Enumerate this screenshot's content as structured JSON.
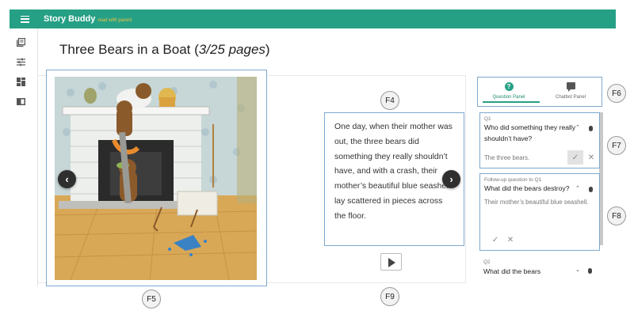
{
  "app": {
    "title": "Story Buddy",
    "subtitle": "read with parent",
    "accent_color": "#26a085"
  },
  "rail": {
    "icons": [
      "library-icon",
      "settings-sliders-icon",
      "dashboard-icon",
      "book-icon"
    ]
  },
  "book": {
    "title": "Three Bears in a Boat (",
    "pages": "3/25 pages",
    "close": ")"
  },
  "reader": {
    "prev_glyph": "‹",
    "next_glyph": "›",
    "story_text": "One day, when their mother was out, the three bears did something they really shouldn’t have, and with a crash, their mother’s beautiful blue seashell lay scattered in pieces across the floor."
  },
  "figure_labels": {
    "f4": "F4",
    "f5": "F5",
    "f6": "F6",
    "f7": "F7",
    "f8": "F8",
    "f9": "F9"
  },
  "panel": {
    "tabs": [
      {
        "label": "Question Panel",
        "icon": "question-icon",
        "active": true
      },
      {
        "label": "Chatbot Panel",
        "icon": "chat-icon",
        "active": false
      }
    ],
    "questions": [
      {
        "tag": "Q1",
        "text": "Who did something they really shouldn’t have?",
        "answer": "The three bears."
      },
      {
        "tag": "Follow-up question to Q1",
        "text": "What did the bears destroy?",
        "answer": "Their mother’s beautiful blue seashell."
      },
      {
        "tag": "Q2",
        "text": "What did the bears"
      }
    ]
  }
}
